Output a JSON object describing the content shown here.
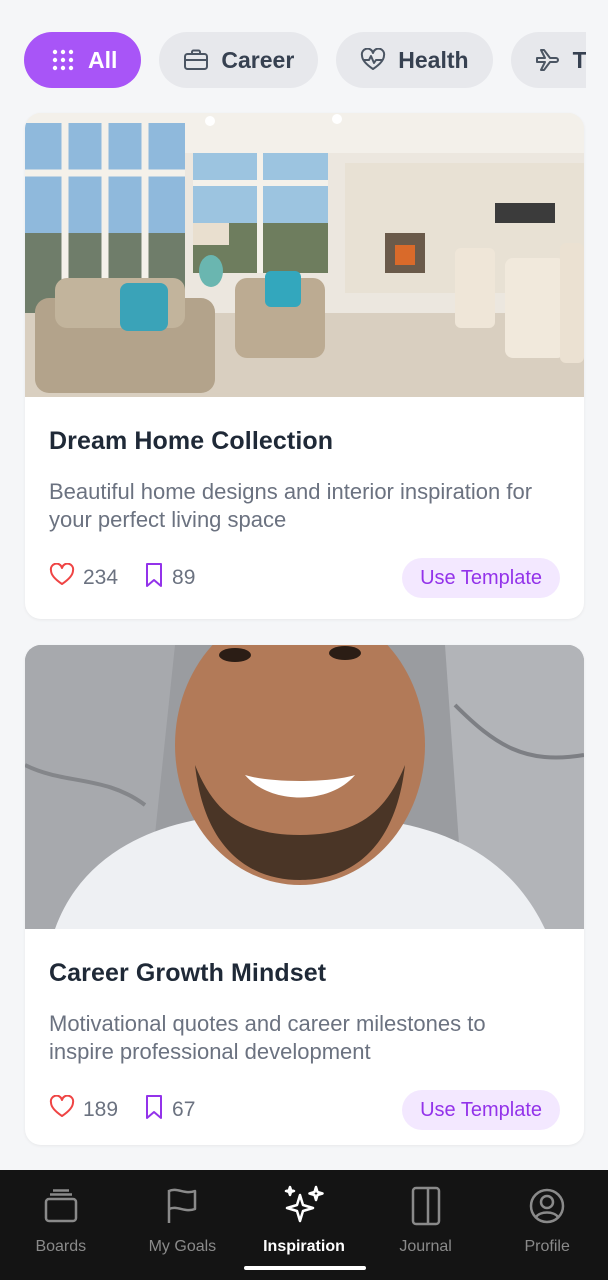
{
  "filters": [
    {
      "label": "All",
      "icon": "grid-icon",
      "active": true
    },
    {
      "label": "Career",
      "icon": "briefcase-icon",
      "active": false
    },
    {
      "label": "Health",
      "icon": "heart-pulse-icon",
      "active": false
    },
    {
      "label": "Travel",
      "icon": "airplane-icon",
      "active": false
    }
  ],
  "cards": [
    {
      "title": "Dream Home Collection",
      "description": "Beautiful home designs and interior inspiration for your perfect living space",
      "likes": "234",
      "saves": "89",
      "button": "Use Template",
      "image": "living-room-photo"
    },
    {
      "title": "Career Growth Mindset",
      "description": "Motivational quotes and career milestones to inspire professional development",
      "likes": "189",
      "saves": "67",
      "button": "Use Template",
      "image": "smiling-man-portrait-photo"
    }
  ],
  "nav": [
    {
      "label": "Boards",
      "icon": "boards-icon",
      "active": false
    },
    {
      "label": "My Goals",
      "icon": "flag-icon",
      "active": false
    },
    {
      "label": "Inspiration",
      "icon": "sparkles-icon",
      "active": true
    },
    {
      "label": "Journal",
      "icon": "journal-icon",
      "active": false
    },
    {
      "label": "Profile",
      "icon": "profile-icon",
      "active": false
    }
  ],
  "colors": {
    "accent": "#a855f7",
    "accent_light": "#f3e8ff",
    "like": "#ef4444",
    "save": "#9333ea",
    "nav_bg": "#141414"
  }
}
